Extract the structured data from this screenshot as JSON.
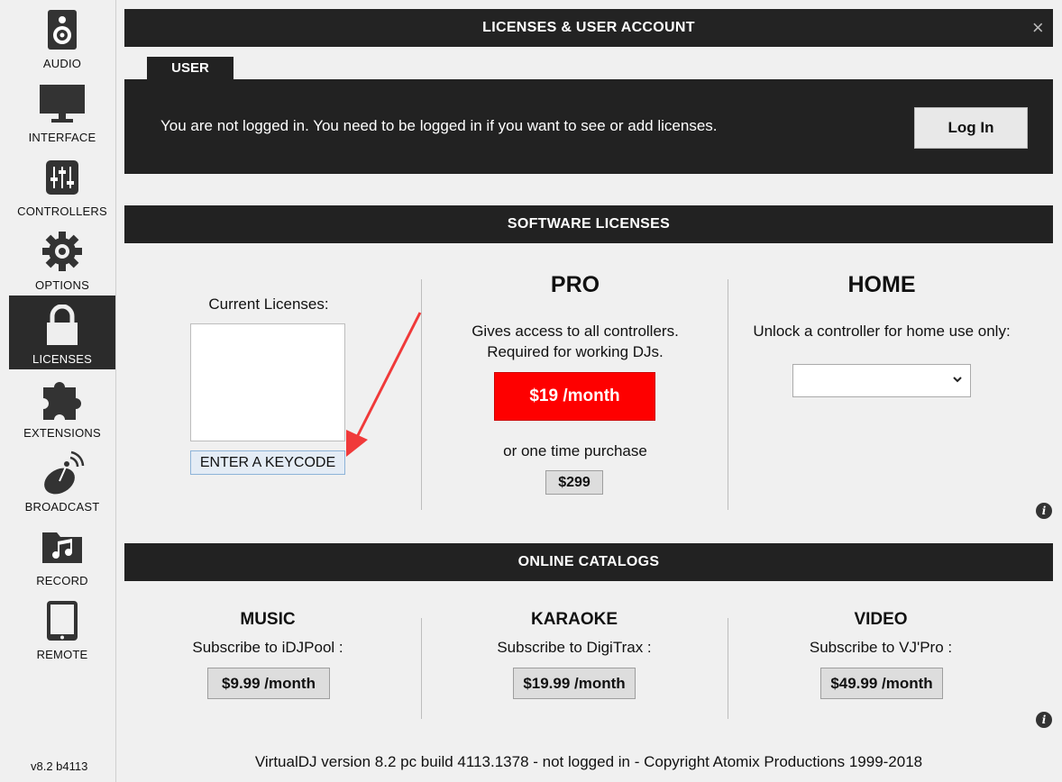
{
  "sidebar": {
    "items": [
      {
        "label": "AUDIO",
        "icon": "speaker-icon"
      },
      {
        "label": "INTERFACE",
        "icon": "monitor-icon"
      },
      {
        "label": "CONTROLLERS",
        "icon": "sliders-icon"
      },
      {
        "label": "OPTIONS",
        "icon": "gear-icon"
      },
      {
        "label": "LICENSES",
        "icon": "lock-icon"
      },
      {
        "label": "EXTENSIONS",
        "icon": "puzzle-icon"
      },
      {
        "label": "BROADCAST",
        "icon": "satellite-dish-icon"
      },
      {
        "label": "RECORD",
        "icon": "music-folder-icon"
      },
      {
        "label": "REMOTE",
        "icon": "tablet-icon"
      }
    ],
    "active": "LICENSES",
    "version": "v8.2 b4113"
  },
  "window": {
    "title": "LICENSES & USER ACCOUNT",
    "close": "×"
  },
  "user": {
    "tab_label": "USER",
    "message": "You are not logged in.  You need to be logged in if you want to see or add licenses.",
    "login_label": "Log In"
  },
  "licenses": {
    "header": "SOFTWARE LICENSES",
    "current_label": "Current Licenses:",
    "keycode_label": "ENTER A KEYCODE",
    "pro": {
      "title": "PRO",
      "desc_line1": "Gives access to all controllers.",
      "desc_line2": "Required for working DJs.",
      "monthly_price": "$19 /month",
      "one_time_label": "or one time purchase",
      "one_time_price": "$299"
    },
    "home": {
      "title": "HOME",
      "desc": "Unlock a controller for home use only:",
      "selected": ""
    }
  },
  "catalogs": {
    "header": "ONLINE CATALOGS",
    "music": {
      "title": "MUSIC",
      "desc": "Subscribe to iDJPool :",
      "price": "$9.99 /month"
    },
    "karaoke": {
      "title": "KARAOKE",
      "desc": "Subscribe to DigiTrax :",
      "price": "$19.99 /month"
    },
    "video": {
      "title": "VIDEO",
      "desc": "Subscribe to VJ'Pro :",
      "price": "$49.99 /month"
    }
  },
  "footer": "VirtualDJ version 8.2 pc build 4113.1378 - not logged in - Copyright Atomix Productions 1999-2018",
  "colors": {
    "accent_red": "#fe0000",
    "dark_bar": "#222222",
    "arrow": "#f03a3a"
  }
}
